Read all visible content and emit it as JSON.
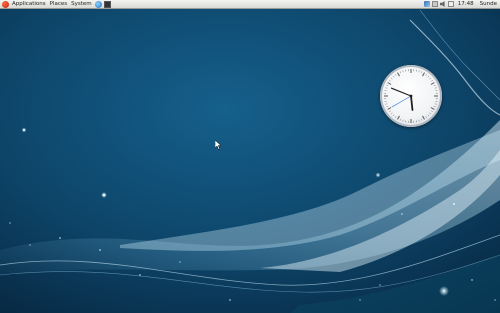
{
  "panel": {
    "menus": [
      "Applications",
      "Places",
      "System"
    ],
    "clock": "17:48",
    "user": "Sunde"
  },
  "icons": {
    "distro_logo": "fedora-logo-icon",
    "launchers": [
      "web-browser-icon",
      "terminal-icon"
    ],
    "tray": [
      "network-icon",
      "update-icon",
      "volume-icon",
      "mail-icon"
    ]
  },
  "desktop": {
    "clock_widget": {
      "hour": 17,
      "minute": 48,
      "second": 40
    }
  },
  "colors": {
    "wallpaper_dark": "#06304f",
    "wallpaper_mid": "#0f4f78",
    "wave_light": "#bfe9ff",
    "panel_top": "#f4f4f2",
    "panel_bottom": "#d9d9d6"
  }
}
